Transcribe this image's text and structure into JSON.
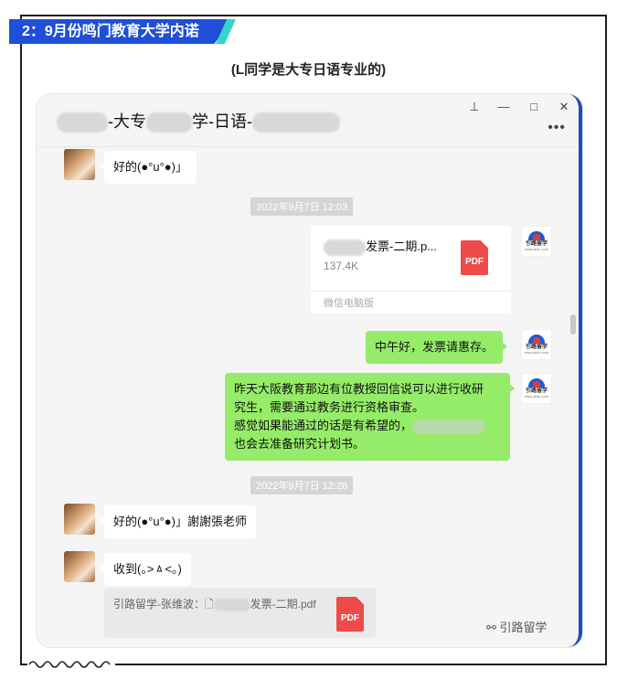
{
  "banner": {
    "text": "2：9月份鸣门教育大学内诺"
  },
  "subtitle": "(L同学是大专日语专业的)",
  "window": {
    "title_part1": "-大专",
    "title_part2": "学-日语-",
    "controls": {
      "pin": "⊥",
      "minimize": "—",
      "maximize": "□",
      "close": "✕",
      "more": "•••"
    }
  },
  "messages": [
    {
      "id": "m1",
      "side": "left",
      "text": "好的(●°u°●)」"
    },
    {
      "id": "ts1",
      "type": "timestamp",
      "text": "2022年9月7日 12:03"
    },
    {
      "id": "m2",
      "side": "right",
      "type": "file",
      "name": "发票-二期.p...",
      "size": "137.4K",
      "source": "微信电脑版",
      "file_icon": "PDF"
    },
    {
      "id": "m3",
      "side": "right",
      "text": "中午好，发票请惠存。"
    },
    {
      "id": "m4",
      "side": "right",
      "lines": [
        "昨天大阪教育那边有位教授回信说可以进行收研",
        "究生，需要通过教务进行资格审查。",
        "感觉如果能通过的话是有希望的，",
        "也会去准备研究计划书。"
      ]
    },
    {
      "id": "ts2",
      "type": "timestamp",
      "text": "2022年9月7日 12:28"
    },
    {
      "id": "m5",
      "side": "left",
      "text": "好的(●°u°●)」謝謝張老师"
    },
    {
      "id": "m6",
      "side": "left",
      "text": "收到(｡>ㅿ<｡)"
    },
    {
      "id": "m7",
      "side": "left",
      "type": "quote",
      "prefix": "引路留学-张维波：",
      "name": "发票-二期.pd",
      "tail": "f",
      "file_icon": "PDF"
    }
  ],
  "logo": {
    "text": "引路留学",
    "url": "www.yinlu.com"
  },
  "watermark": "引路留学"
}
